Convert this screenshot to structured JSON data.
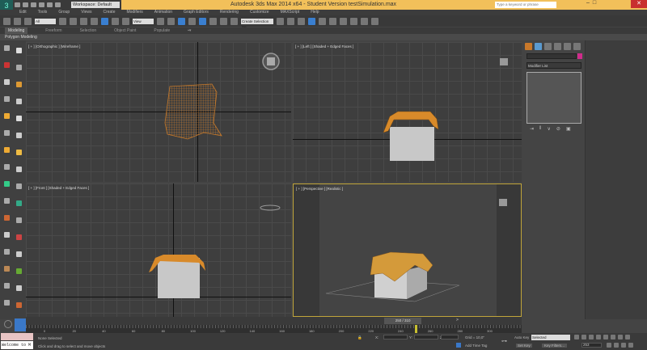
{
  "titlebar": {
    "title": "Autodesk 3ds Max  2014 x64   - Student Version    testSimulation.max",
    "workspace": "Workspace: Default",
    "search_placeholder": "Type a keyword or phrase",
    "minimize": "–",
    "maximize": "□",
    "close": "✕"
  },
  "menu": [
    "Edit",
    "Tools",
    "Group",
    "Views",
    "Create",
    "Modifiers",
    "Animation",
    "Graph Editors",
    "Rendering",
    "Customize",
    "MAXScript",
    "Help"
  ],
  "toolbar": {
    "selection_filter": "All",
    "ref_coord": "View",
    "named_selection": "Create Selection Se"
  },
  "ribbon": {
    "tabs": [
      "Modeling",
      "Freeform",
      "Selection",
      "Object Paint",
      "Populate"
    ],
    "panel": "Polygon Modeling"
  },
  "viewports": {
    "top_left": "[ + ] [Orthographic ] [Wireframe ]",
    "top_right": "[ + ] [Left ] [Shaded + Edged Faces ]",
    "bottom_left": "[ + ] [Front ] [Shaded + Edged Faces ]",
    "bottom_right": "[ + ] [Perspective ] [Realistic ]"
  },
  "command_panel": {
    "modifier_list": "Modifier List",
    "accent": "#d02c8c"
  },
  "timeline": {
    "current": "250 / 310",
    "frame": 250,
    "end": 310,
    "ticks": [
      "0",
      "20",
      "40",
      "60",
      "80",
      "100",
      "120",
      "140",
      "160",
      "180",
      "200",
      "220",
      "240",
      "260",
      "280",
      "300"
    ]
  },
  "status": {
    "selection": "None Selected",
    "prompt": "Click and drag to select and move objects",
    "welcome": "Welcome to M",
    "x_label": "X:",
    "y_label": "Y:",
    "z_label": "Z:",
    "grid": "Grid = 10,0\"",
    "add_time_tag": "Add Time Tag",
    "auto_key": "Auto Key",
    "set_key": "Set Key",
    "key_mode": "Selected",
    "key_filters": "Key Filters...",
    "frame_field": "253"
  }
}
